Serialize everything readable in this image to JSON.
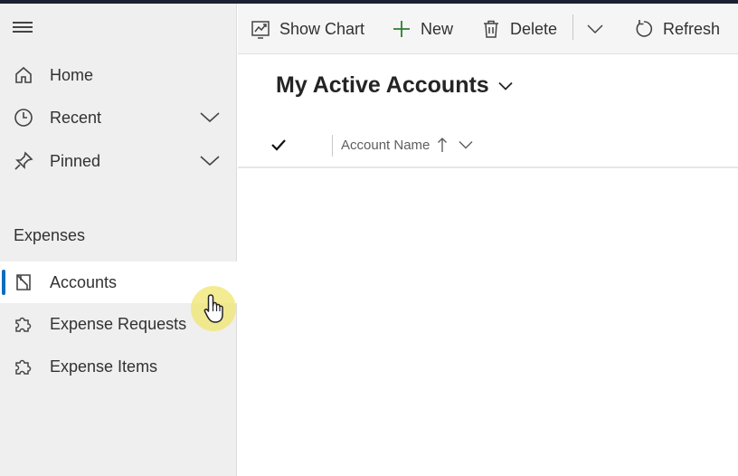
{
  "sidebar": {
    "menu_icon": "hamburger-icon",
    "items": [
      {
        "label": "Home",
        "icon": "home-icon"
      },
      {
        "label": "Recent",
        "icon": "clock-icon",
        "expandable": true
      },
      {
        "label": "Pinned",
        "icon": "pin-icon",
        "expandable": true
      }
    ],
    "section": {
      "title": "Expenses",
      "items": [
        {
          "label": "Accounts",
          "icon": "account-book-icon",
          "active": true
        },
        {
          "label": "Expense Requests",
          "icon": "puzzle-icon"
        },
        {
          "label": "Expense Items",
          "icon": "puzzle-icon"
        }
      ]
    }
  },
  "commandbar": {
    "show_chart": "Show Chart",
    "new": "New",
    "delete": "Delete",
    "refresh": "Refresh"
  },
  "view": {
    "title": "My Active Accounts"
  },
  "grid": {
    "columns": [
      {
        "label": "Account Name",
        "sort": "ascending"
      }
    ]
  },
  "colors": {
    "active_indicator": "#0f6cbd",
    "new_plus": "#2e7d32",
    "cursor_highlight": "#f0e66e"
  }
}
